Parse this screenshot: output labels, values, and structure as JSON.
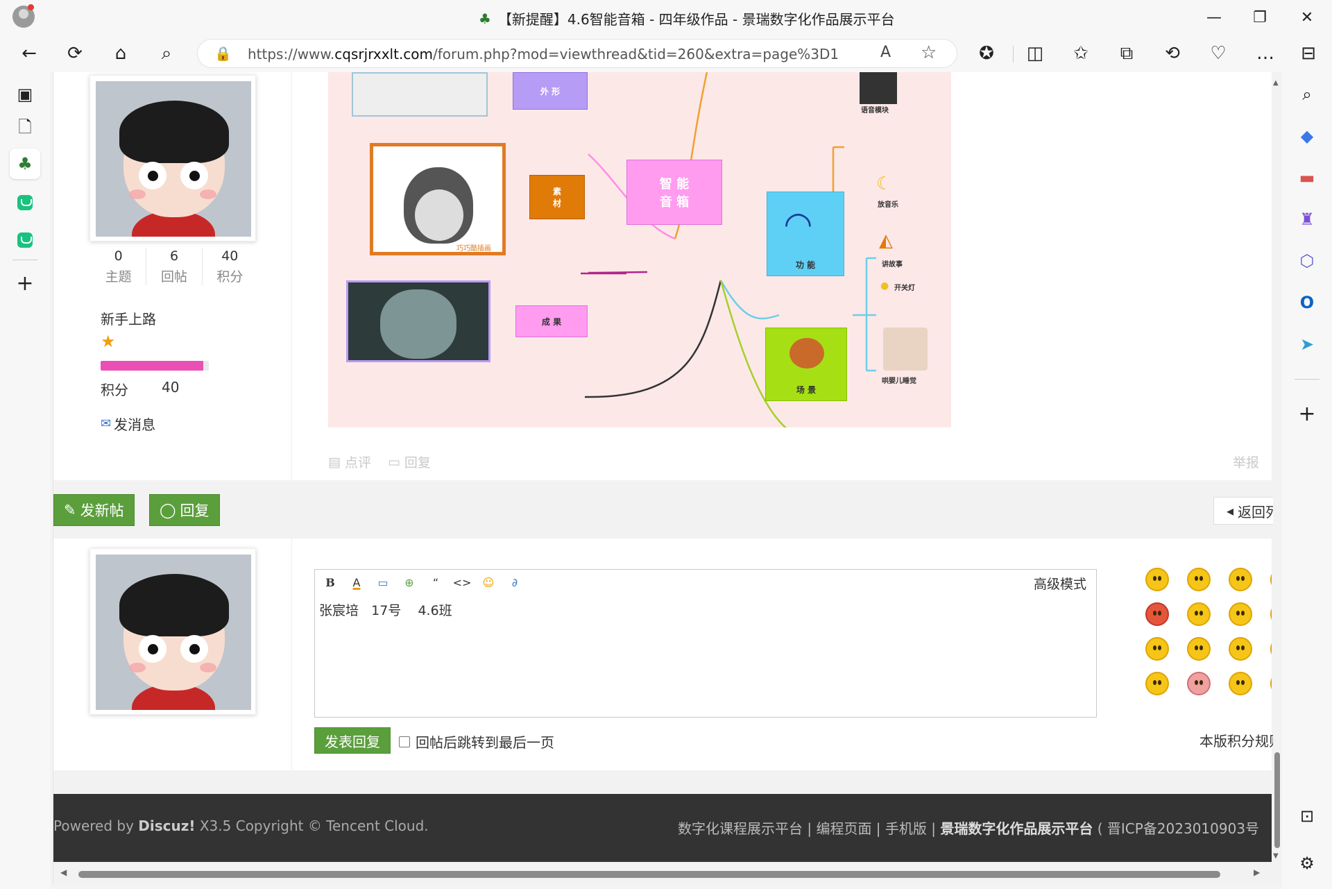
{
  "browser": {
    "tab_title": "【新提醒】4.6智能音箱 - 四年级作品 - 景瑞数字化作品展示平台",
    "url_prefix": "https://www.",
    "url_domain": "cqsrjrxxlt.com",
    "url_path": "/forum.php?mod=viewthread&tid=260&extra=page%3D1",
    "read_aloud": "A",
    "icons": {
      "back": "←",
      "refresh": "⟳",
      "home": "⌂",
      "search": "⌕",
      "lock": "🔒",
      "favorite": "☆",
      "extensions": "✪",
      "split": "◫",
      "favorites": "✩",
      "collections": "⧉",
      "history": "⟲",
      "health": "♡",
      "more": "…",
      "sidebar": "⊟",
      "minimize": "—",
      "restore": "❐",
      "close": "✕"
    }
  },
  "left_sidebar": {
    "icons": {
      "tabs": "▣",
      "page": "🗋",
      "site": "♣",
      "add": "+"
    }
  },
  "right_sidebar": {
    "icons": {
      "search": "⌕",
      "tag": "◆",
      "briefcase": "▬",
      "chess": "♜",
      "m365": "⬡",
      "outlook": "O",
      "send": "➤",
      "add": "+",
      "screenshot": "⊡",
      "settings": "⚙"
    }
  },
  "profile": {
    "stats": [
      {
        "num": "0",
        "label": "主题"
      },
      {
        "num": "6",
        "label": "回帖"
      },
      {
        "num": "40",
        "label": "积分"
      }
    ],
    "rank_title": "新手上路",
    "star": "★",
    "rank_progress": 0.95,
    "points_label": "积分",
    "points_value": "40",
    "send_message": "发消息",
    "mail_icon": "✉"
  },
  "mindmap": {
    "center": "智 能\n音 箱",
    "waixing": "外 形",
    "sucai": "素\n材",
    "chengguo": "成 果",
    "gongneng": "功 能",
    "changjing": "场 景",
    "yuyin": "语音模块",
    "bofang": "放音乐",
    "jiangushi": "讲故事",
    "kaiguan": "开关灯",
    "baby": "哄婴儿睡觉",
    "watermark": "巧巧酷插画"
  },
  "post_actions": {
    "comment": "点评",
    "reply": "回复",
    "report": "举报"
  },
  "buttons": {
    "new_post": "发新帖",
    "reply": "回复",
    "back": "返回列表"
  },
  "editor": {
    "bold": "B",
    "font_color": "A",
    "quote": "“",
    "code": "<>",
    "advanced_mode": "高级模式",
    "content": "张宸培   17号    4.6班",
    "submit": "发表回复",
    "checkbox_label": "回帖后跳转到最后一页",
    "rules": "本版积分规则"
  },
  "footer": {
    "powered": "Powered by ",
    "discuz": "Discuz!",
    "version": " X3.5",
    "copyright": " Copyright © Tencent Cloud.",
    "links": "数字化课程展示平台 | 编程页面 | 手机版 | ",
    "site": "景瑞数字化作品展示平台",
    "icp": " ( 晋ICP备2023010903号"
  },
  "colors": {
    "accent_green": "#5b9f3d",
    "footer_bg": "#333333",
    "rank_bar": "#ea4fb5",
    "mindmap_bg": "#fde8e8"
  }
}
